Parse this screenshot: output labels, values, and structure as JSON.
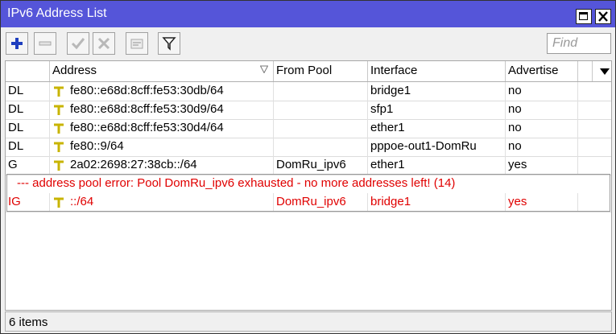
{
  "window": {
    "title": "IPv6 Address List"
  },
  "toolbar": {
    "buttons": [
      {
        "name": "add-button",
        "icon": "plus-icon"
      },
      {
        "name": "remove-button",
        "icon": "minus-icon"
      },
      {
        "name": "enable-button",
        "icon": "check-icon"
      },
      {
        "name": "disable-button",
        "icon": "cross-icon"
      },
      {
        "name": "comment-button",
        "icon": "note-icon"
      },
      {
        "name": "filter-button",
        "icon": "filter-icon"
      }
    ],
    "find_placeholder": "Find"
  },
  "table": {
    "columns": [
      "",
      "Address",
      "From Pool",
      "Interface",
      "Advertise"
    ],
    "rows": [
      {
        "flags": "DL",
        "address": "fe80::e68d:8cff:fe53:30db/64",
        "from_pool": "",
        "interface": "bridge1",
        "advertise": "no"
      },
      {
        "flags": "DL",
        "address": "fe80::e68d:8cff:fe53:30d9/64",
        "from_pool": "",
        "interface": "sfp1",
        "advertise": "no"
      },
      {
        "flags": "DL",
        "address": "fe80::e68d:8cff:fe53:30d4/64",
        "from_pool": "",
        "interface": "ether1",
        "advertise": "no"
      },
      {
        "flags": "DL",
        "address": "fe80::9/64",
        "from_pool": "",
        "interface": "pppoe-out1-DomRu",
        "advertise": "no"
      },
      {
        "flags": "G",
        "address": "2a02:2698:27:38cb::/64",
        "from_pool": "DomRu_ipv6",
        "interface": "ether1",
        "advertise": "yes"
      }
    ],
    "error_comment": "--- address pool error: Pool DomRu_ipv6 exhausted - no more addresses left! (14)",
    "invalid_row": {
      "flags": "IG",
      "address": "::/64",
      "from_pool": "DomRu_ipv6",
      "interface": "bridge1",
      "advertise": "yes"
    }
  },
  "status": {
    "count": "6 items"
  },
  "colors": {
    "title_bar": "#5555d9",
    "error": "#e00000",
    "add_icon": "#1f3fbf",
    "address_icon": "#c8b400"
  }
}
